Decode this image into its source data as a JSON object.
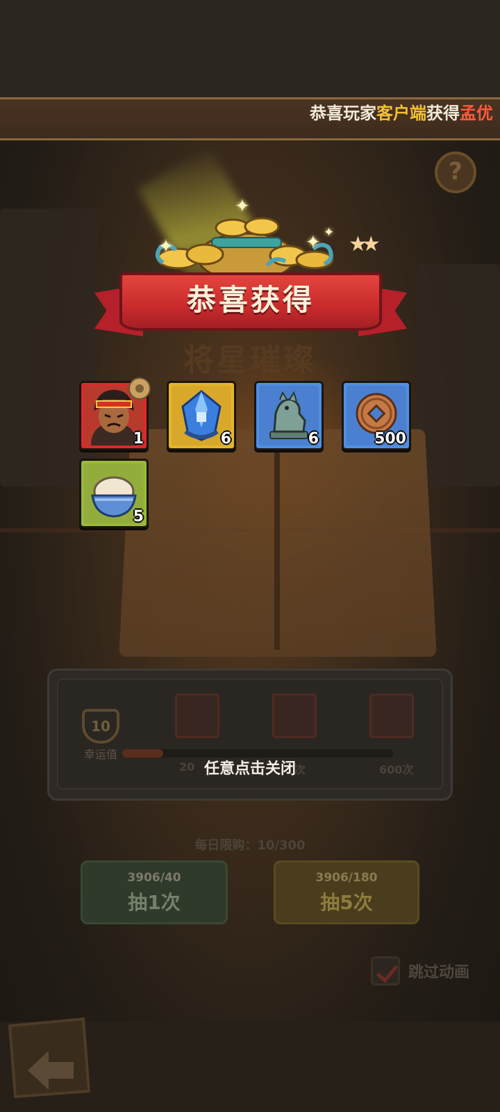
{
  "broadcast": {
    "prefix": "恭喜玩家",
    "player": "客户端",
    "middle": "获得",
    "hero": "孟优"
  },
  "help_icon": "?",
  "header": {
    "title": "恭喜获得"
  },
  "background": {
    "title": "将星璀璨",
    "lucky_value": "10",
    "lucky_label": "幸运值",
    "milestones": [
      "20",
      "次",
      "600次"
    ],
    "daily_limit": "每日限购：10/300",
    "draw1": {
      "cost": "3906/40",
      "label": "抽1次"
    },
    "draw5": {
      "cost": "3906/180",
      "label": "抽5次"
    },
    "skip_animation": "跳过动画"
  },
  "rewards": [
    {
      "name": "hero-portrait-icon",
      "quantity": "1",
      "frame": "#d92b2b"
    },
    {
      "name": "blue-gem-icon",
      "quantity": "6",
      "frame": "#e3b52a"
    },
    {
      "name": "jade-beast-statue-icon",
      "quantity": "6",
      "frame": "#4f8fe3"
    },
    {
      "name": "copper-coin-icon",
      "quantity": "500",
      "frame": "#4f8fe3"
    },
    {
      "name": "rice-bowl-icon",
      "quantity": "5",
      "frame": "#9ab83a"
    }
  ],
  "close_hint": "任意点击关闭"
}
